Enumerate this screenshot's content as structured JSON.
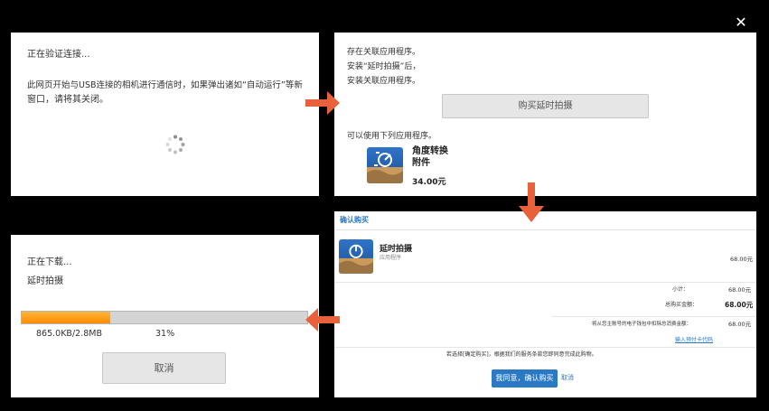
{
  "panel1": {
    "title": "正在验证连接...",
    "line1": "此网页开始与USB连接的相机进行通信时，如果弹出诸如“自动运行”等新",
    "line2": "窗口，请将其关闭。"
  },
  "panel2": {
    "line1": "存在关联应用程序。",
    "line2": "安装“延时拍摄”后，",
    "line3": "安装关联应用程序。",
    "buy_button": "购买延时拍摄",
    "available_label": "可以使用下列应用程序。",
    "app_name_line1": "角度转换",
    "app_name_line2": "附件",
    "app_price": "34.00元"
  },
  "panel3": {
    "status_line1": "正在下载...",
    "status_line2": "延时拍摄",
    "progress_fraction": 0.31,
    "size_text": "865.0KB/2.8MB",
    "percent_text": "31%",
    "cancel_button": "取消"
  },
  "panel4": {
    "header": "确认购买",
    "app_name": "延时拍摄",
    "app_sub": "应用程序",
    "item_price": "68.00元",
    "subtotal_label": "小计：",
    "subtotal_value": "68.00元",
    "total_label": "总购买金额：",
    "total_value": "68.00元",
    "wallet_label": "将从您主账号的电子钱包中扣除总消费金额：",
    "wallet_value": "68.00元",
    "voucher_link": "输入预付卡代码",
    "agree_text": "若选择[确定购买]，根据我们的服务条款您即同意完成此购物。",
    "confirm_button": "我同意，确认购买",
    "cancel_link": "取消"
  },
  "colors": {
    "arrow": "#e8613a",
    "progress": "#ff8c00",
    "link_blue": "#2b78c5",
    "panel4_header": "#2b78c5"
  },
  "icons": {
    "spinner": "loading-spinner-icon",
    "close": "close-icon",
    "app1": "angle-converter-app-icon",
    "app2": "timelapse-app-icon"
  }
}
